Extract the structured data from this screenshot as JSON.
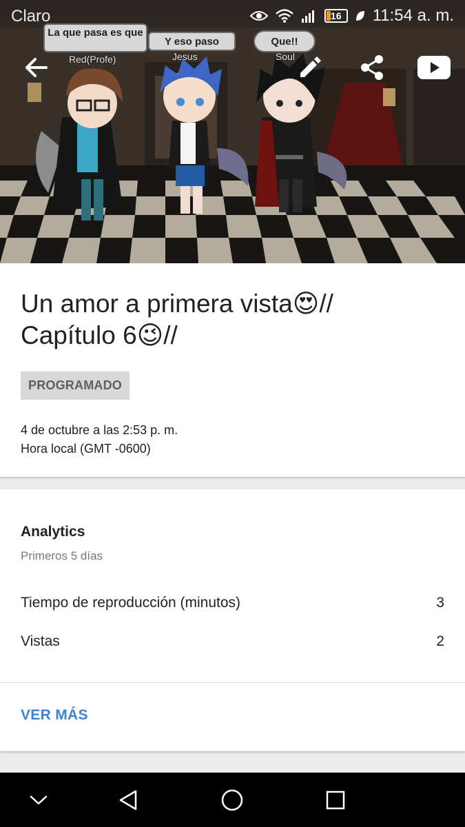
{
  "status_bar": {
    "carrier": "Claro",
    "time": "11:54 a. m.",
    "battery": "16"
  },
  "toolbar": {
    "back_icon": "arrow-back-icon",
    "edit_icon": "pencil-icon",
    "share_icon": "share-icon",
    "youtube_icon": "youtube-icon"
  },
  "thumbnail": {
    "bubbles": [
      {
        "text": "La que pasa es que",
        "name": "Red(Profe)"
      },
      {
        "text": "Y eso paso",
        "name": "Jesus"
      },
      {
        "text": "Que!!",
        "name": "Soul"
      }
    ]
  },
  "video": {
    "title": "Un amor a primera vista😍// Capítulo 6😉//",
    "status_badge": "PROGRAMADO",
    "schedule_date": "4 de octubre a las 2:53 p. m.",
    "timezone": "Hora local (GMT -0600)"
  },
  "analytics": {
    "title": "Analytics",
    "subtitle": "Primeros 5 días",
    "metrics": [
      {
        "label": "Tiempo de reproducción (minutos)",
        "value": "3"
      },
      {
        "label": "Vistas",
        "value": "2"
      }
    ],
    "see_more": "VER MÁS"
  },
  "colors": {
    "accent": "#3e82d6",
    "badge_bg": "#d8d8d8",
    "navbar": "#000000"
  },
  "nav_bar": {
    "icons": [
      "collapse-chevron-icon",
      "back-triangle-icon",
      "home-circle-icon",
      "recents-square-icon"
    ]
  }
}
